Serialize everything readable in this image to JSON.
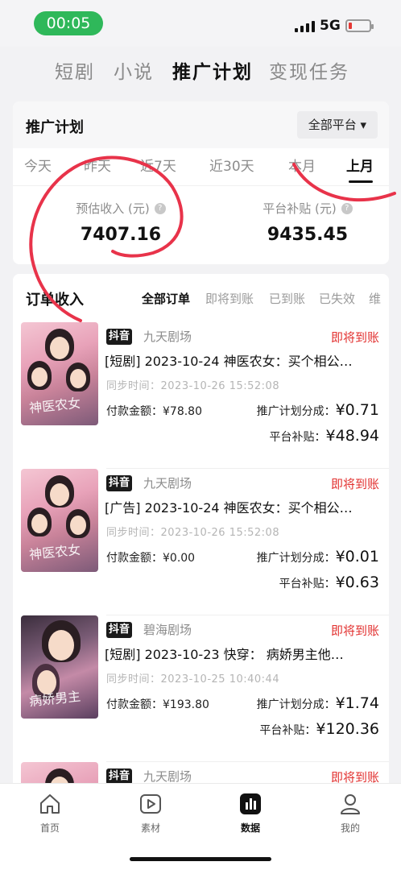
{
  "status_bar": {
    "time": "00:05",
    "network": "5G",
    "battery_level": 0.08
  },
  "top_tabs": [
    {
      "label": "短剧",
      "active": false
    },
    {
      "label": "小说",
      "active": false
    },
    {
      "label": "推广计划",
      "active": true
    },
    {
      "label": "变现任务",
      "active": false
    }
  ],
  "plan": {
    "title": "推广计划",
    "platform_label": "全部平台 ▾",
    "periods": [
      "今天",
      "昨天",
      "近7天",
      "近30天",
      "本月",
      "上月"
    ],
    "active_period": "上月",
    "stats": [
      {
        "label": "预估收入 (元)",
        "value": "7407.16"
      },
      {
        "label": "平台补贴 (元)",
        "value": "9435.45"
      }
    ]
  },
  "orders": {
    "title": "订单收入",
    "filters": [
      "全部订单",
      "即将到账",
      "已到账",
      "已失效",
      "维"
    ],
    "active_filter": "全部订单",
    "items": [
      {
        "tag": "抖音",
        "theater": "九天剧场",
        "status": "即将到账",
        "title": "[短剧] 2023-10-24 神医农女：买个相公…",
        "sync_label": "同步时间：",
        "sync_time": "2023-10-26 15:52:08",
        "pay_label": "付款金额：",
        "pay_value": "¥78.80",
        "share_label": "推广计划分成：",
        "share_value": "¥0.71",
        "subsidy_label": "平台补贴：",
        "subsidy_value": "¥48.94",
        "cover_art": "神医农女"
      },
      {
        "tag": "抖音",
        "theater": "九天剧场",
        "status": "即将到账",
        "title": "[广告] 2023-10-24 神医农女：买个相公…",
        "sync_label": "同步时间：",
        "sync_time": "2023-10-26 15:52:08",
        "pay_label": "付款金额：",
        "pay_value": "¥0.00",
        "share_label": "推广计划分成：",
        "share_value": "¥0.01",
        "subsidy_label": "平台补贴：",
        "subsidy_value": "¥0.63",
        "cover_art": "神医农女"
      },
      {
        "tag": "抖音",
        "theater": "碧海剧场",
        "status": "即将到账",
        "title": "[短剧] 2023-10-23 快穿： 病娇男主他…",
        "sync_label": "同步时间：",
        "sync_time": "2023-10-25 10:40:44",
        "pay_label": "付款金额：",
        "pay_value": "¥193.80",
        "share_label": "推广计划分成：",
        "share_value": "¥1.74",
        "subsidy_label": "平台补贴：",
        "subsidy_value": "¥120.36",
        "cover_art": "病娇男主"
      },
      {
        "tag": "抖音",
        "theater": "九天剧场",
        "status": "即将到账",
        "title": "",
        "sync_label": "",
        "sync_time": "",
        "pay_label": "",
        "pay_value": "",
        "share_label": "",
        "share_value": "",
        "subsidy_label": "",
        "subsidy_value": "",
        "cover_art": ""
      }
    ]
  },
  "bottom_nav": [
    {
      "label": "首页",
      "icon": "home-icon",
      "active": false
    },
    {
      "label": "素材",
      "icon": "play-icon",
      "active": false
    },
    {
      "label": "数据",
      "icon": "chart-icon",
      "active": true
    },
    {
      "label": "我的",
      "icon": "person-icon",
      "active": false
    }
  ],
  "colors": {
    "accent_status": "#e2302f",
    "pill_green": "#2fb85a",
    "annotation_red": "#e8334a"
  }
}
